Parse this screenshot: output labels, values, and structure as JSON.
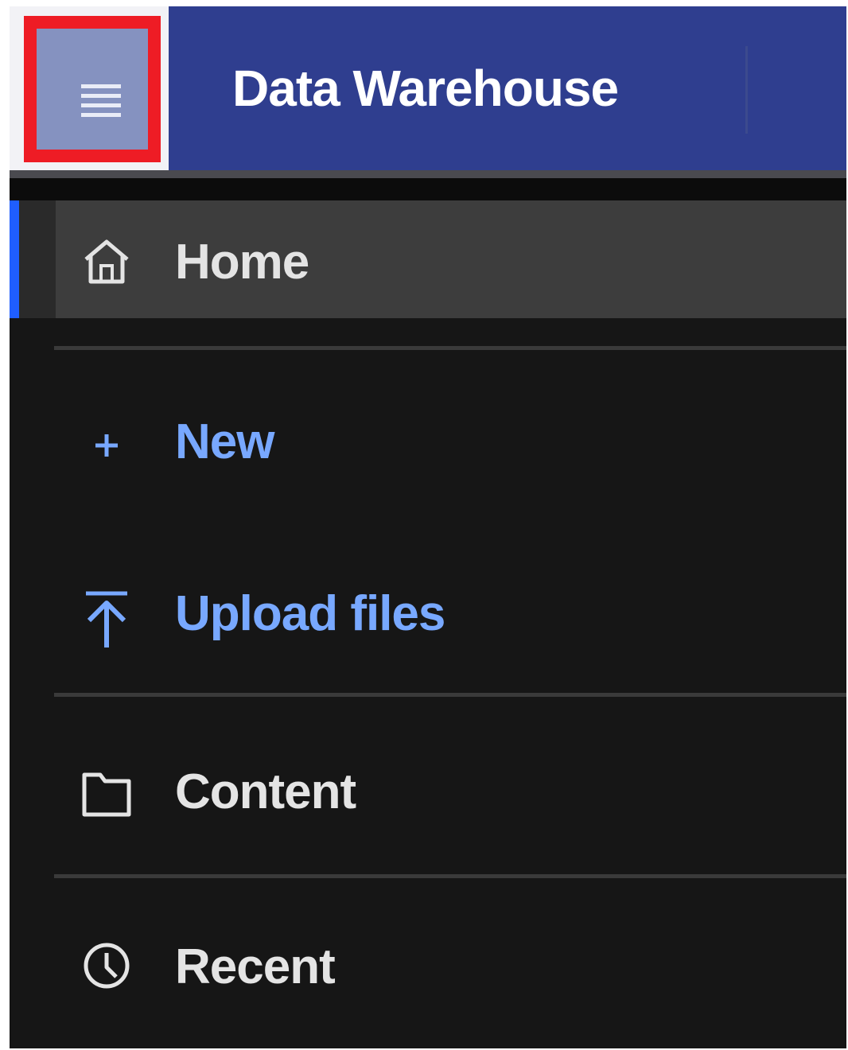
{
  "header": {
    "menu_icon": "hamburger-menu-icon",
    "title": "Data Warehouse"
  },
  "colors": {
    "header_bg": "#2f3e8f",
    "sidebar_bg": "#161616",
    "active_item_bg": "#3d3d3d",
    "active_indicator": "#1f5eff",
    "action_text": "#78a8ff",
    "highlight_box": "#ee1c25"
  },
  "nav": {
    "home": {
      "label": "Home",
      "icon": "home-icon"
    },
    "new": {
      "label": "New",
      "icon": "plus-icon"
    },
    "upload": {
      "label": "Upload files",
      "icon": "upload-icon"
    },
    "content": {
      "label": "Content",
      "icon": "folder-icon"
    },
    "recent": {
      "label": "Recent",
      "icon": "clock-icon"
    }
  }
}
